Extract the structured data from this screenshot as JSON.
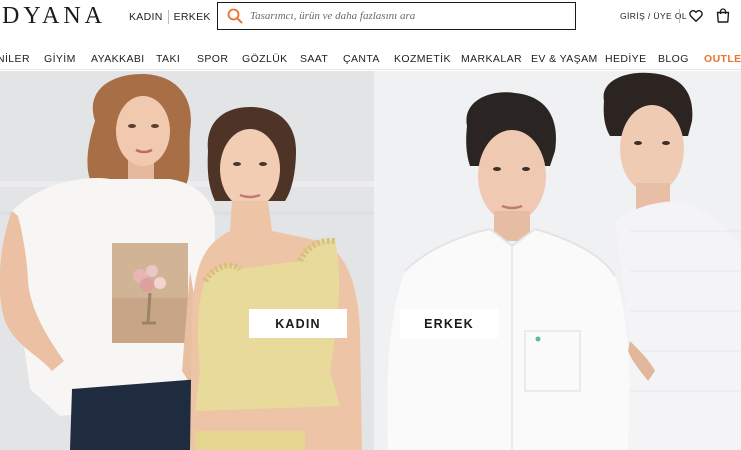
{
  "header": {
    "logo_text": "DYANA",
    "gender_links": [
      "KADIN",
      "ERKEK"
    ],
    "search_placeholder": "Tasarımcı, ürün ve daha fazlasını ara",
    "login_label": "GİRİŞ / ÜYE OL",
    "search_icon": "search-icon",
    "favorites_icon": "heart-icon",
    "cart_icon": "shopping-bag-icon",
    "accent_color": "#e8742c"
  },
  "nav": {
    "items": [
      "NİLER",
      "GİYİM",
      "AYAKKABI",
      "TAKI",
      "SPOR",
      "GÖZLÜK",
      "SAAT",
      "ÇANTA",
      "KOZMETİK",
      "MARKALAR",
      "EV & YAŞAM",
      "HEDİYE",
      "BLOG",
      "OUTLET"
    ]
  },
  "hero": {
    "women_button": "KADIN",
    "men_button": "ERKEK"
  }
}
